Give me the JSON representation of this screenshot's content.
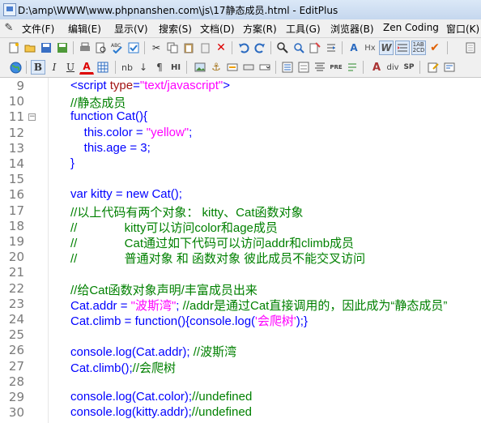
{
  "window": {
    "title": "D:\\amp\\WWW\\www.phpnanshen.com\\js\\17静态成员.html - EditPlus"
  },
  "menu": [
    {
      "label": "文件(F)"
    },
    {
      "label": "编辑(E)"
    },
    {
      "label": "显示(V)"
    },
    {
      "label": "搜索(S)"
    },
    {
      "label": "文档(D)"
    },
    {
      "label": "方案(R)"
    },
    {
      "label": "工具(G)"
    },
    {
      "label": "浏览器(B)"
    },
    {
      "label": "Zen Coding"
    },
    {
      "label": "窗口(K)"
    }
  ],
  "toolbar1_icons": [
    "new-file-icon",
    "open-icon",
    "save-icon",
    "save-all-icon",
    "print-icon",
    "print-preview-icon",
    "spell-check-icon",
    "cut-icon",
    "copy-icon",
    "paste-icon",
    "delete-icon",
    "undo-icon",
    "redo-icon",
    "find-icon",
    "replace-icon",
    "find-in-files-icon",
    "goto-icon",
    "word-wrap-icon",
    "show-hidden-icon",
    "column-select-icon",
    "abc-icon",
    "check-icon",
    "clip-icon"
  ],
  "toolbar2_labels": {
    "bold": "B",
    "italic": "I",
    "underline": "U",
    "font_color": "A",
    "nb": "nb",
    "ln": "↓",
    "para": "¶",
    "hr": "HI",
    "pre": "PRE",
    "div": "div",
    "sp": "SP"
  },
  "code": {
    "line_numbers": [
      "9",
      "10",
      "11",
      "12",
      "13",
      "14",
      "15",
      "16",
      "17",
      "18",
      "19",
      "20",
      "21",
      "22",
      "23",
      "24",
      "25",
      "26",
      "27",
      "28",
      "29",
      "30"
    ],
    "lines": [
      [
        {
          "t": "<script ",
          "c": "c-tag"
        },
        {
          "t": "type",
          "c": "c-attr"
        },
        {
          "t": "=",
          "c": "c-tag"
        },
        {
          "t": "\"text/javascript\"",
          "c": "c-str"
        },
        {
          "t": ">",
          "c": "c-tag"
        }
      ],
      [
        {
          "t": "//静态成员",
          "c": "c-cmt"
        }
      ],
      [
        {
          "t": "function ",
          "c": "c-kw"
        },
        {
          "t": "Cat(){",
          "c": "c-kw"
        }
      ],
      [
        {
          "t": "    this",
          "c": "c-kw"
        },
        {
          "t": ".color = ",
          "c": "c-kw"
        },
        {
          "t": "\"yellow\"",
          "c": "c-str"
        },
        {
          "t": ";",
          "c": "c-kw"
        }
      ],
      [
        {
          "t": "    this",
          "c": "c-kw"
        },
        {
          "t": ".age = 3;",
          "c": "c-kw"
        }
      ],
      [
        {
          "t": "}",
          "c": "c-kw"
        }
      ],
      [],
      [
        {
          "t": "var ",
          "c": "c-kw"
        },
        {
          "t": "kitty = ",
          "c": "c-kw"
        },
        {
          "t": "new ",
          "c": "c-kw"
        },
        {
          "t": "Cat();",
          "c": "c-kw"
        }
      ],
      [
        {
          "t": "//以上代码有两个对象： kitty、Cat函数对象",
          "c": "c-cmt"
        }
      ],
      [
        {
          "t": "//              kitty可以访问color和age成员",
          "c": "c-cmt"
        }
      ],
      [
        {
          "t": "//              Cat通过如下代码可以访问addr和climb成员",
          "c": "c-cmt"
        }
      ],
      [
        {
          "t": "//              普通对象 和 函数对象 彼此成员不能交叉访问",
          "c": "c-cmt"
        }
      ],
      [],
      [
        {
          "t": "//给Cat函数对象声明/丰富成员出来",
          "c": "c-cmt"
        }
      ],
      [
        {
          "t": "Cat.addr = ",
          "c": "c-kw"
        },
        {
          "t": "\"波斯湾\"",
          "c": "c-str"
        },
        {
          "t": "; ",
          "c": "c-kw"
        },
        {
          "t": "//addr是通过Cat直接调用的，因此成为“静态成员”",
          "c": "c-cmt"
        }
      ],
      [
        {
          "t": "Cat.climb = ",
          "c": "c-kw"
        },
        {
          "t": "function",
          "c": "c-kw"
        },
        {
          "t": "(){console.log(",
          "c": "c-kw"
        },
        {
          "t": "'会爬树'",
          "c": "c-str"
        },
        {
          "t": ");}",
          "c": "c-kw"
        }
      ],
      [],
      [
        {
          "t": "console.log(Cat.addr); ",
          "c": "c-kw"
        },
        {
          "t": "//波斯湾",
          "c": "c-cmt"
        }
      ],
      [
        {
          "t": "Cat.climb();",
          "c": "c-kw"
        },
        {
          "t": "//会爬树",
          "c": "c-cmt"
        }
      ],
      [],
      [
        {
          "t": "console.log(Cat.color);",
          "c": "c-kw"
        },
        {
          "t": "//undefined",
          "c": "c-cmt"
        }
      ],
      [
        {
          "t": "console.log(kitty.addr);",
          "c": "c-kw"
        },
        {
          "t": "//undefined",
          "c": "c-cmt"
        }
      ]
    ]
  }
}
